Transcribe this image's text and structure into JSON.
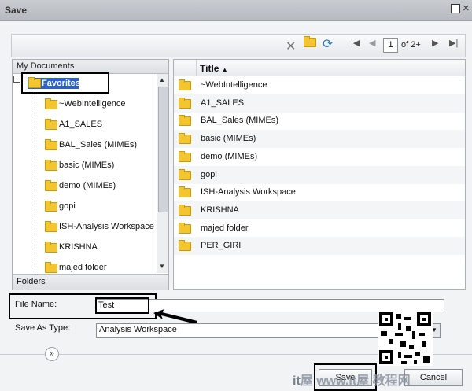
{
  "window": {
    "title": "Save"
  },
  "toolbar": {
    "page_value": "1",
    "page_of": "of 2+"
  },
  "left_panel": {
    "header": "My Documents",
    "footer": "Folders",
    "selected": "Favorites",
    "items": [
      "~WebIntelligence",
      "A1_SALES",
      "BAL_Sales (MIMEs)",
      "basic (MIMEs)",
      "demo (MIMEs)",
      "gopi",
      "ISH-Analysis Workspace",
      "KRISHNA",
      "majed folder"
    ]
  },
  "right_panel": {
    "column_title": "Title",
    "items": [
      "~WebIntelligence",
      "A1_SALES",
      "BAL_Sales (MIMEs)",
      "basic (MIMEs)",
      "demo (MIMEs)",
      "gopi",
      "ISH-Analysis Workspace",
      "KRISHNA",
      "majed folder",
      "PER_GIRI"
    ]
  },
  "form": {
    "file_name_label": "File Name:",
    "file_name_value": "Test",
    "save_as_type_label": "Save As Type:",
    "save_as_type_value": "Analysis Workspace"
  },
  "buttons": {
    "save": "Save",
    "cancel": "Cancel",
    "more": "»"
  },
  "watermark": {
    "prefix": "it",
    "text": "屋 www.it屋 教程网 "
  }
}
